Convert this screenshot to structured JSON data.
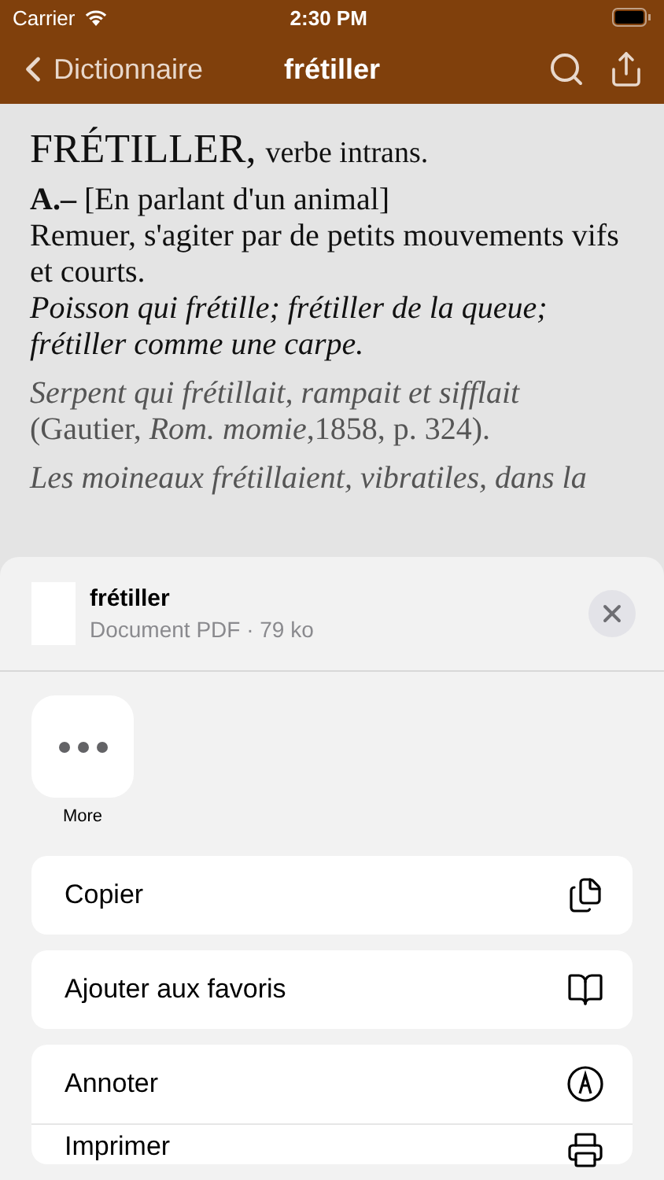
{
  "status_bar": {
    "carrier": "Carrier",
    "time": "2:30 PM"
  },
  "nav_bar": {
    "back_label": "Dictionnaire",
    "title": "frétiller"
  },
  "entry": {
    "headword": "FRÉTILLER,",
    "part_of_speech": "verbe intrans.",
    "paragraphs": [
      {
        "kind": "sense",
        "text": "**A.–** [En parlant d'un animal]"
      },
      {
        "kind": "definition",
        "text": "Remuer, s'agiter par de petits mouvements vifs et courts."
      },
      {
        "kind": "example",
        "text": "Poisson qui frétille; frétiller de la queue; frétiller comme une carpe."
      },
      {
        "kind": "citation",
        "text": "*Serpent qui frétillait, rampait et sifflait* (Gautier, *Rom. momie*,1858, p. 324)."
      },
      {
        "kind": "citation_italic",
        "text": "Les moineaux frétillaient, vibratiles, dans la"
      }
    ]
  },
  "share_sheet": {
    "file_name": "frétiller",
    "file_info": "Document PDF · 79 ko",
    "apps": [
      {
        "label": "More"
      }
    ],
    "action_groups": [
      [
        {
          "label": "Copier",
          "kind": "copy"
        }
      ],
      [
        {
          "label": "Ajouter aux favoris",
          "kind": "bookmark"
        }
      ],
      [
        {
          "label": "Annoter",
          "kind": "markup"
        },
        {
          "label": "Imprimer",
          "kind": "print"
        }
      ]
    ]
  }
}
